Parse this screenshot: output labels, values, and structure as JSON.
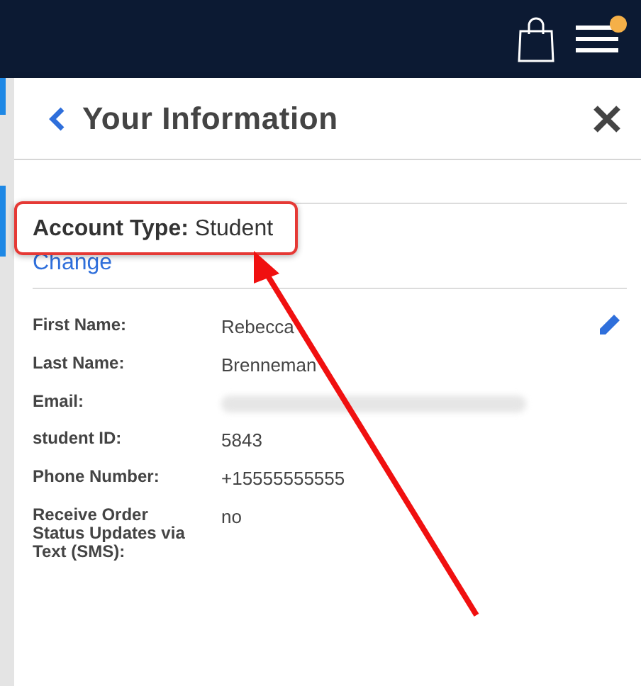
{
  "top_bar": {
    "notification": true
  },
  "panel": {
    "title": "Your Information",
    "account_type": {
      "label": "Account Type:",
      "value": "Student",
      "link": "Change"
    },
    "fields": [
      {
        "kind": "text",
        "label": "First Name:",
        "value": "Rebecca",
        "editable": true
      },
      {
        "kind": "text",
        "label": "Last Name:",
        "value": "Brenneman",
        "editable": false
      },
      {
        "kind": "blurred",
        "label": "Email:",
        "editable": false
      },
      {
        "kind": "text",
        "label": "student ID:",
        "value": "5843",
        "editable": false
      },
      {
        "kind": "text",
        "label": "Phone Number:",
        "value": "+15555555555",
        "editable": false
      },
      {
        "kind": "text",
        "label": "Receive Order Status Updates via Text (SMS):",
        "value": "no",
        "editable": false
      }
    ]
  },
  "annotation": {
    "highlight": true,
    "arrow": true
  }
}
